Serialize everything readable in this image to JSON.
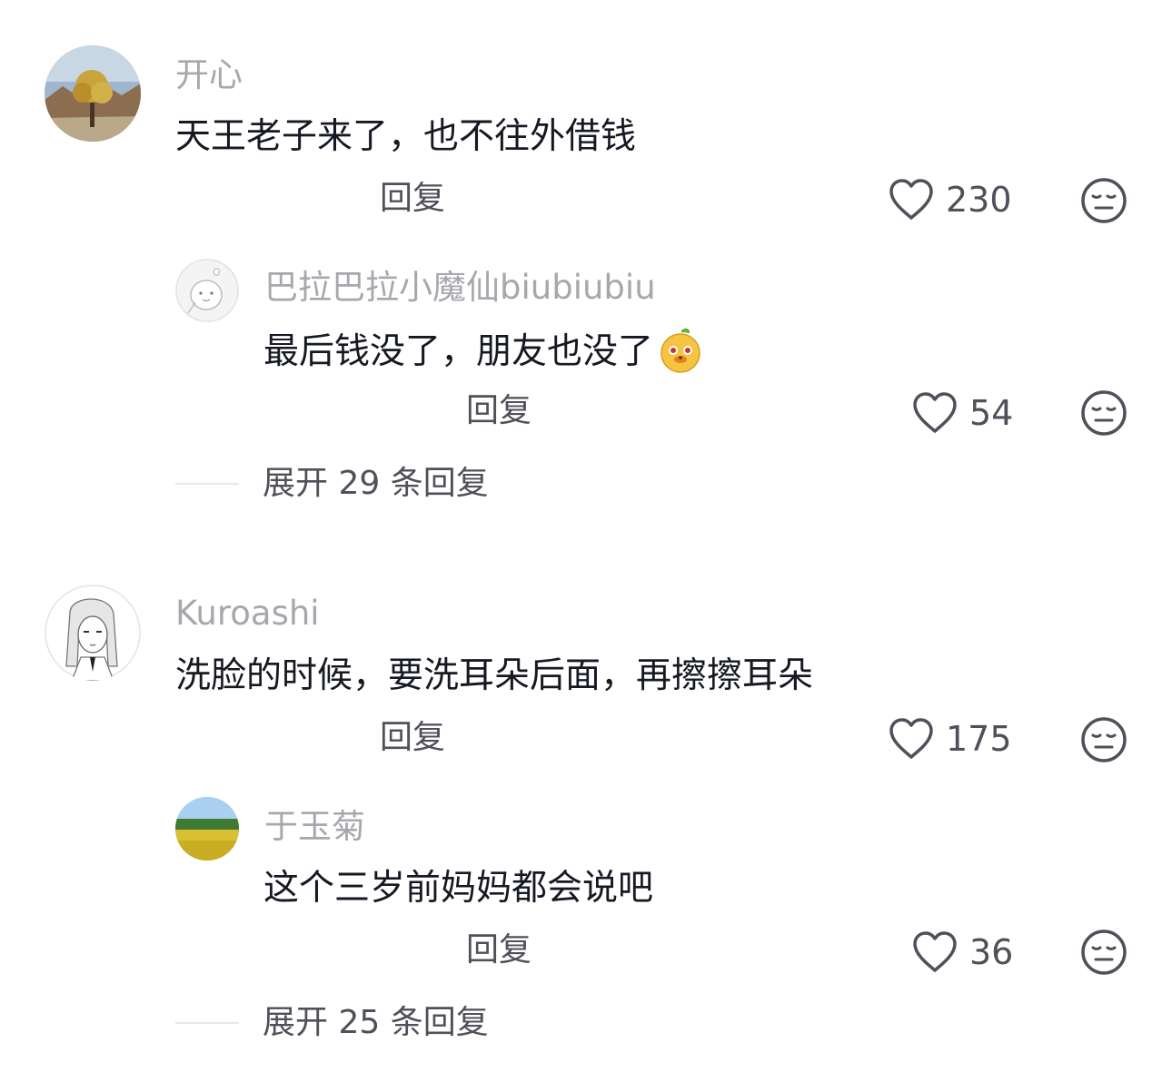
{
  "comments": [
    {
      "username": "开心",
      "text": "天王老子来了，也不往外借钱",
      "reply_label": "回复",
      "likes": "230",
      "replies": [
        {
          "username": "巴拉巴拉小魔仙biubiubiu",
          "text": "最后钱没了，朋友也没了",
          "reply_label": "回复",
          "likes": "54"
        }
      ],
      "expand_label": "展开 29 条回复"
    },
    {
      "username": "Kuroashi",
      "text": "洗脸的时候，要洗耳朵后面，再擦擦耳朵",
      "reply_label": "回复",
      "likes": "175",
      "replies": [
        {
          "username": "于玉菊",
          "text": "这个三岁前妈妈都会说吧",
          "reply_label": "回复",
          "likes": "36"
        }
      ],
      "expand_label": "展开 25 条回复"
    }
  ],
  "icons": {
    "like": "heart-outline-icon",
    "dislike": "neutral-face-icon",
    "emoji": "sticker-emoji-icon"
  },
  "colors": {
    "text_primary": "#161823",
    "text_secondary": "#4f5059",
    "username": "#a7a8ad",
    "divider": "#e8e8ea"
  }
}
